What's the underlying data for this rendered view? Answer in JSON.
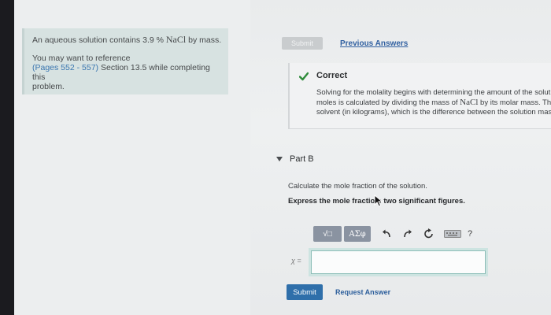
{
  "intro": {
    "prefix": "An aqueous solution contains 3.9 % ",
    "chem": "NaCl",
    "suffix": " by mass."
  },
  "reference": {
    "line1": "You may want to reference",
    "pages": "(Pages 552 - 557)",
    "section": " Section 13.5 while completing this",
    "line3": "problem."
  },
  "part_a": {
    "submit_label": "Submit",
    "previous_answers_label": "Previous Answers",
    "status": "Correct",
    "feedback_line1": "Solving for the molality begins with determining the amount of the solut",
    "feedback_line2_prefix": "moles is calculated by dividing the mass of ",
    "feedback_line2_chem": "NaCl",
    "feedback_line2_suffix": " by its molar mass. Th",
    "feedback_line3": "solvent (in kilograms), which is the difference between the solution mass"
  },
  "part_b": {
    "title": "Part B",
    "question": "Calculate the mole fraction of the solution.",
    "instruction": "Express the mole fractio  o two significant figures.",
    "answer_label": "χ =",
    "answer_value": "",
    "submit_label": "Submit",
    "request_answer_label": "Request Answer",
    "toolbar": {
      "math_label": "√□",
      "greek_label": "ΑΣφ",
      "help_label": "?"
    }
  }
}
